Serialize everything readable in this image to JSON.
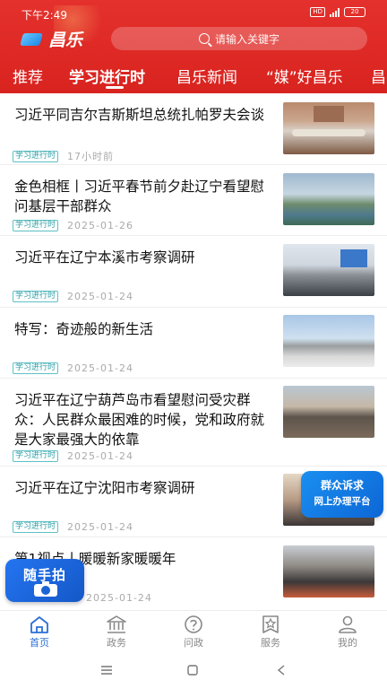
{
  "status": {
    "time": "下午2:49",
    "hd": "HD",
    "battery": "20"
  },
  "app": {
    "name": "昌乐"
  },
  "search": {
    "placeholder": "请输入关键字"
  },
  "tabs": [
    {
      "label": "推荐"
    },
    {
      "label": "学习进行时"
    },
    {
      "label": "昌乐新闻"
    },
    {
      "label": "“媒”好昌乐"
    },
    {
      "label": "昌"
    }
  ],
  "news": [
    {
      "title": "习近平同吉尔吉斯斯坦总统扎帕罗夫会谈",
      "tag": "学习进行时",
      "time": "17小时前"
    },
    {
      "title": "金色相框丨习近平春节前夕赴辽宁看望慰问基层干部群众",
      "tag": "学习进行时",
      "time": "2025-01-26"
    },
    {
      "title": "习近平在辽宁本溪市考察调研",
      "tag": "学习进行时",
      "time": "2025-01-24"
    },
    {
      "title": "特写：奇迹般的新生活",
      "tag": "学习进行时",
      "time": "2025-01-24"
    },
    {
      "title": "习近平在辽宁葫芦岛市看望慰问受灾群众：人民群众最困难的时候，党和政府就是大家最强大的依靠",
      "tag": "学习进行时",
      "time": "2025-01-24"
    },
    {
      "title": "习近平在辽宁沈阳市考察调研",
      "tag": "学习进行时",
      "time": "2025-01-24"
    },
    {
      "title": "第1视点丨暖暖新家暖暖年",
      "tag": "",
      "time": "2025-01-24"
    }
  ],
  "promo": {
    "line1": "群众诉求",
    "line2": "网上办理平台"
  },
  "shoot": {
    "label": "随手拍"
  },
  "nav": [
    {
      "label": "首页",
      "icon": "home-icon"
    },
    {
      "label": "政务",
      "icon": "government-icon"
    },
    {
      "label": "问政",
      "icon": "question-icon"
    },
    {
      "label": "服务",
      "icon": "service-star-icon"
    },
    {
      "label": "我的",
      "icon": "user-icon"
    }
  ],
  "colors": {
    "header": "#e0302b",
    "tag": "#2a9fa5",
    "nav_active": "#2b6fd6"
  }
}
